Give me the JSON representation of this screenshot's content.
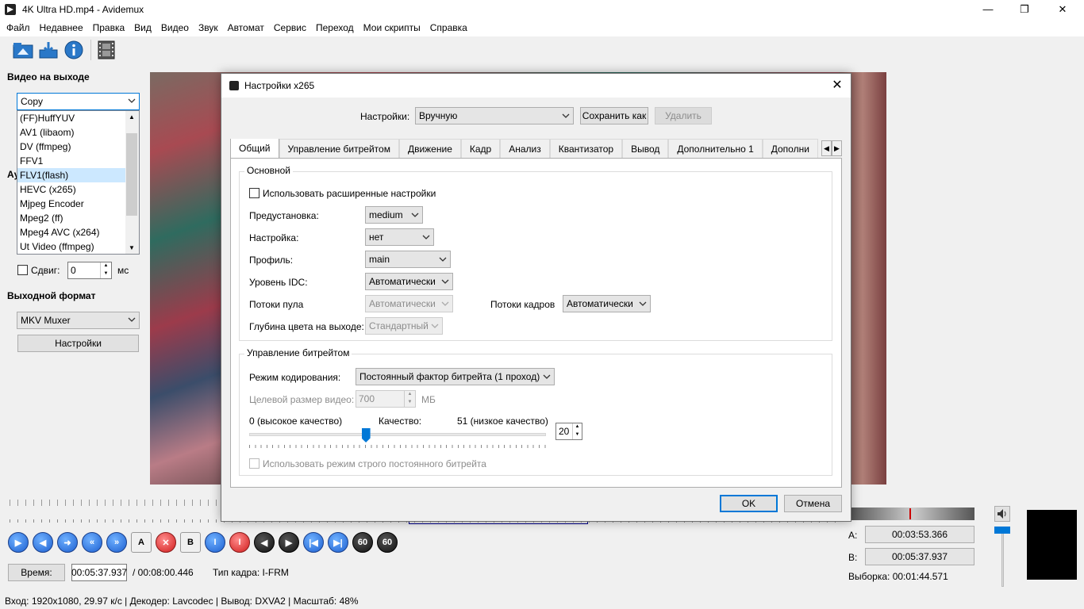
{
  "window": {
    "title": "4K Ultra HD.mp4 - Avidemux"
  },
  "menu": [
    "Файл",
    "Недавнее",
    "Правка",
    "Вид",
    "Видео",
    "Звук",
    "Автомат",
    "Сервис",
    "Переход",
    "Мои скрипты",
    "Справка"
  ],
  "left": {
    "video_output_label": "Видео на выходе",
    "video_codec_selected": "Copy",
    "codec_list": [
      "(FF)HuffYUV",
      "AV1 (libaom)",
      "DV (ffmpeg)",
      "FFV1",
      "FLV1(flash)",
      "HEVC (x265)",
      "Mjpeg Encoder",
      "Mpeg2 (ff)",
      "Mpeg4 AVC (x264)",
      "Ut Video (ffmpeg)"
    ],
    "codec_list_selected_index": 4,
    "audio_label_partial": "Ау",
    "shift_label": "Сдвиг:",
    "shift_value": "0",
    "shift_unit": "мс",
    "output_format_label": "Выходной формат",
    "muxer_selected": "MKV Muxer",
    "settings_button": "Настройки"
  },
  "dialog": {
    "title": "Настройки x265",
    "preset_label": "Настройки:",
    "preset_value": "Вручную",
    "save_as_button": "Сохранить как",
    "delete_button": "Удалить",
    "tabs": [
      "Общий",
      "Управление битрейтом",
      "Движение",
      "Кадр",
      "Анализ",
      "Квантизатор",
      "Вывод",
      "Дополнительно 1",
      "Дополни"
    ],
    "basic_group": "Основной",
    "advanced_checkbox": "Использовать расширенные настройки",
    "preset_row_label": "Предустановка:",
    "preset_row_value": "medium",
    "tune_label": "Настройка:",
    "tune_value": "нет",
    "profile_label": "Профиль:",
    "profile_value": "main",
    "idc_label": "Уровень IDC:",
    "idc_value": "Автоматически",
    "pool_threads_label": "Потоки пула",
    "pool_threads_value": "Автоматически",
    "frame_threads_label": "Потоки кадров",
    "frame_threads_value": "Автоматически",
    "depth_label": "Глубина цвета на выходе:",
    "depth_value": "Стандартный",
    "bitrate_group": "Управление битрейтом",
    "encoding_mode_label": "Режим кодирования:",
    "encoding_mode_value": "Постоянный фактор битрейта (1 проход)",
    "target_size_label": "Целевой размер видео:",
    "target_size_value": "700",
    "target_size_unit": "МБ",
    "quality_low_label": "0 (высокое качество)",
    "quality_label": "Качество:",
    "quality_high_label": "51 (низкое качество)",
    "quality_value": "20",
    "quality_slider_fraction": 0.392,
    "strict_cbr_checkbox": "Использовать режим строго постоянного битрейта",
    "ok_button": "OK",
    "cancel_button": "Отмена"
  },
  "playback": {
    "time_button": "Время:",
    "current_time": "00:05:37.937",
    "total_time": "/ 00:08:00.446",
    "frame_type": "Тип кадра:  I-FRM",
    "a_label": "A:",
    "a_value": "00:03:53.366",
    "b_label": "B:",
    "b_value": "00:05:37.937",
    "selection": "Выборка: 00:01:44.571"
  },
  "status": "Вход: 1920x1080, 29.97 к/с  |  Декодер: Lavcodec  |  Вывод: DXVA2  |  Масштаб: 48%"
}
